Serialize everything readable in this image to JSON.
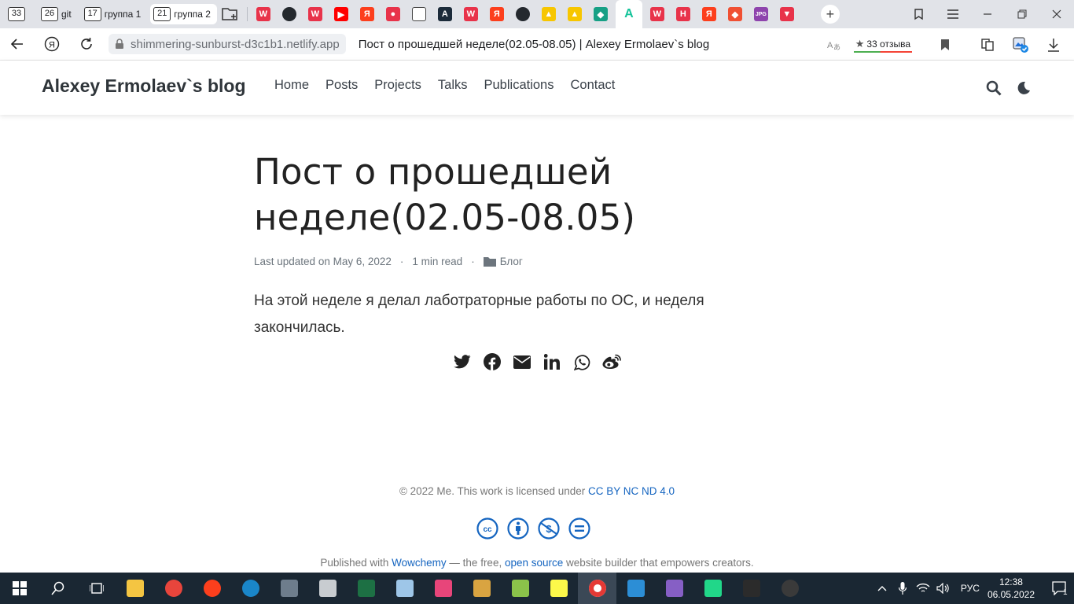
{
  "browser": {
    "tab_groups": [
      {
        "count": "33",
        "label": ""
      },
      {
        "count": "26",
        "label": "git"
      },
      {
        "count": "17",
        "label": "группа 1"
      },
      {
        "count": "21",
        "label": "группа 2"
      }
    ],
    "active_group_index": 3,
    "tab_icons": [
      {
        "name": "w-icon",
        "glyph": "W",
        "bg": "#e8334a"
      },
      {
        "name": "github-icon",
        "glyph": "",
        "bg": "#24292e"
      },
      {
        "name": "w-icon",
        "glyph": "W",
        "bg": "#e8334a"
      },
      {
        "name": "youtube-icon",
        "glyph": "▶",
        "bg": "#ff0000"
      },
      {
        "name": "yandex-icon",
        "glyph": "Я",
        "bg": "#fc3f1d"
      },
      {
        "name": "pin-icon",
        "glyph": "●",
        "bg": "#e8334a"
      },
      {
        "name": "document-icon",
        "glyph": "",
        "bg": "#ffffff"
      },
      {
        "name": "a-icon",
        "glyph": "A",
        "bg": "#1b2b3a"
      },
      {
        "name": "w-icon",
        "glyph": "W",
        "bg": "#e8334a"
      },
      {
        "name": "yandex-icon",
        "glyph": "Я",
        "bg": "#fc3f1d"
      },
      {
        "name": "github-icon",
        "glyph": "",
        "bg": "#24292e"
      },
      {
        "name": "image-icon",
        "glyph": "▲",
        "bg": "#f7c600"
      },
      {
        "name": "image-icon",
        "glyph": "▲",
        "bg": "#f7c600"
      },
      {
        "name": "diamond-icon",
        "glyph": "◆",
        "bg": "#16a085"
      },
      {
        "name": "netlify-icon",
        "glyph": "A",
        "bg": "#15c39a"
      },
      {
        "name": "w-icon",
        "glyph": "W",
        "bg": "#e8334a"
      },
      {
        "name": "h-icon",
        "glyph": "H",
        "bg": "#e8334a"
      },
      {
        "name": "yandex-icon",
        "glyph": "Я",
        "bg": "#fc3f1d"
      },
      {
        "name": "git-icon",
        "glyph": "◆",
        "bg": "#f05033"
      },
      {
        "name": "jpg-icon",
        "glyph": "JPG",
        "bg": "#8e44ad"
      },
      {
        "name": "tag-icon",
        "glyph": "▼",
        "bg": "#e8334a"
      }
    ],
    "current_icon_index": 14,
    "url": "shimmering-sunburst-d3c1b1.netlify.app",
    "page_title": "Пост о прошедшей неделе(02.05-08.05) | Alexey Ermolaev`s blog",
    "reviews_label": "33 отзыва"
  },
  "site": {
    "brand": "Alexey Ermolaev`s blog",
    "nav": [
      "Home",
      "Posts",
      "Projects",
      "Talks",
      "Publications",
      "Contact"
    ]
  },
  "post": {
    "title": "Пост о прошедшей неделе(02.05-08.05)",
    "last_updated": "Last updated on May 6, 2022",
    "read_time": "1 min read",
    "category": "Блог",
    "body": "На этой неделе я делал лаботраторные работы по ОС, и неделя закончилась."
  },
  "footer": {
    "copyright_prefix": "© 2022 Me. This work is licensed under ",
    "license_link": "CC BY NC ND 4.0",
    "published_prefix": "Published with ",
    "wowchemy_link": "Wowchemy",
    "published_middle": " — the free, ",
    "open_source_link": "open source",
    "published_suffix": " website builder that empowers creators."
  },
  "taskbar": {
    "language": "РУС",
    "time": "12:38",
    "date": "06.05.2022",
    "notification_count": "1"
  },
  "colors": {
    "link": "#1565c0",
    "taskbar": "#1a2733",
    "tab_strip": "#e1e3e8"
  }
}
